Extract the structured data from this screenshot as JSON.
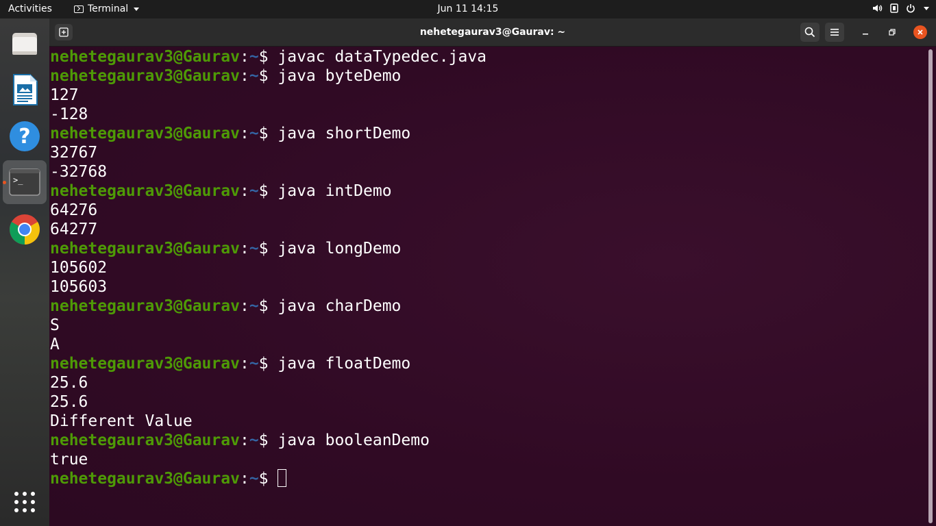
{
  "topbar": {
    "activities_label": "Activities",
    "app_menu_label": "Terminal",
    "clock": "Jun 11  14:15",
    "icons": [
      "volume-icon",
      "network-icon",
      "power-icon",
      "chevron-down-icon"
    ]
  },
  "dock": {
    "items": [
      {
        "name": "files",
        "icon": "folder-icon"
      },
      {
        "name": "libreoffice-impress",
        "icon": "presentation-icon"
      },
      {
        "name": "help",
        "icon": "help-icon",
        "glyph": "?"
      },
      {
        "name": "terminal",
        "icon": "terminal-icon",
        "glyph": ">_",
        "active": true
      },
      {
        "name": "chrome",
        "icon": "chrome-icon"
      }
    ],
    "show_apps_icon": "grid-icon"
  },
  "window": {
    "title": "nehetegaurav3@Gaurav: ~",
    "buttons": [
      "new-tab",
      "search",
      "menu",
      "minimize",
      "maximize",
      "close"
    ]
  },
  "terminal": {
    "prompt": {
      "user_host": "nehetegaurav3@Gaurav",
      "colon": ":",
      "path": "~",
      "symbol": "$ "
    },
    "lines": [
      {
        "kind": "cmd",
        "text": "javac dataTypedec.java"
      },
      {
        "kind": "cmd",
        "text": "java byteDemo"
      },
      {
        "kind": "out",
        "text": "127"
      },
      {
        "kind": "out",
        "text": "-128"
      },
      {
        "kind": "cmd",
        "text": "java shortDemo"
      },
      {
        "kind": "out",
        "text": "32767"
      },
      {
        "kind": "out",
        "text": "-32768"
      },
      {
        "kind": "cmd",
        "text": "java intDemo"
      },
      {
        "kind": "out",
        "text": "64276"
      },
      {
        "kind": "out",
        "text": "64277"
      },
      {
        "kind": "cmd",
        "text": "java longDemo"
      },
      {
        "kind": "out",
        "text": "105602"
      },
      {
        "kind": "out",
        "text": "105603"
      },
      {
        "kind": "cmd",
        "text": "java charDemo"
      },
      {
        "kind": "out",
        "text": "S"
      },
      {
        "kind": "out",
        "text": "A"
      },
      {
        "kind": "cmd",
        "text": "java floatDemo"
      },
      {
        "kind": "out",
        "text": "25.6"
      },
      {
        "kind": "out",
        "text": "25.6"
      },
      {
        "kind": "out",
        "text": "Different Value"
      },
      {
        "kind": "cmd",
        "text": "java booleanDemo"
      },
      {
        "kind": "out",
        "text": "true"
      },
      {
        "kind": "prompt",
        "text": ""
      }
    ]
  },
  "colors": {
    "terminal_bg": "#300a24",
    "prompt_user": "#4e9a06",
    "prompt_path": "#3465a4",
    "accent": "#e95420"
  }
}
